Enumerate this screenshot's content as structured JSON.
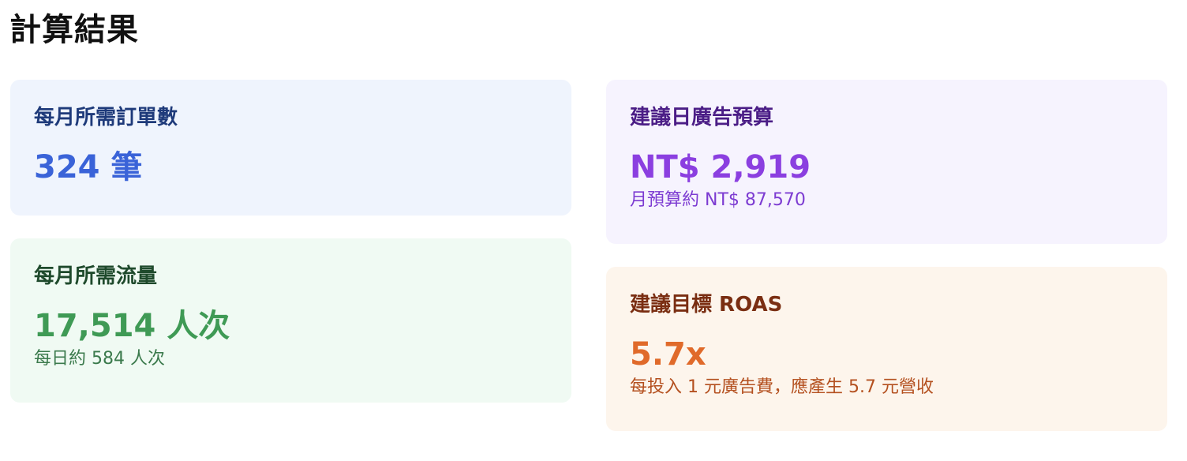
{
  "page": {
    "title": "計算結果"
  },
  "cards": {
    "monthly_orders": {
      "label": "每月所需訂單數",
      "value": "324 筆",
      "bg_color": "#eff4fd",
      "label_color": "#1e3a7a",
      "value_color": "#3a63d8"
    },
    "monthly_traffic": {
      "label": "每月所需流量",
      "value": "17,514 人次",
      "sub": "每日約 584 人次",
      "bg_color": "#f0faf3",
      "label_color": "#1f4a2c",
      "value_color": "#3f9a55",
      "sub_color": "#3b7a4c"
    },
    "daily_budget": {
      "label": "建議日廣告預算",
      "value": "NT$ 2,919",
      "sub": "月預算約 NT$ 87,570",
      "bg_color": "#f6f3fe",
      "label_color": "#4b1d86",
      "value_color": "#8b3fe0",
      "sub_color": "#7d3cd2"
    },
    "target_roas": {
      "label": "建議目標 ROAS",
      "value": "5.7x",
      "sub": "每投入 1 元廣告費，應產生 5.7 元營收",
      "bg_color": "#fdf5ec",
      "label_color": "#7a2e12",
      "value_color": "#e06a2a",
      "sub_color": "#b4501f"
    }
  }
}
